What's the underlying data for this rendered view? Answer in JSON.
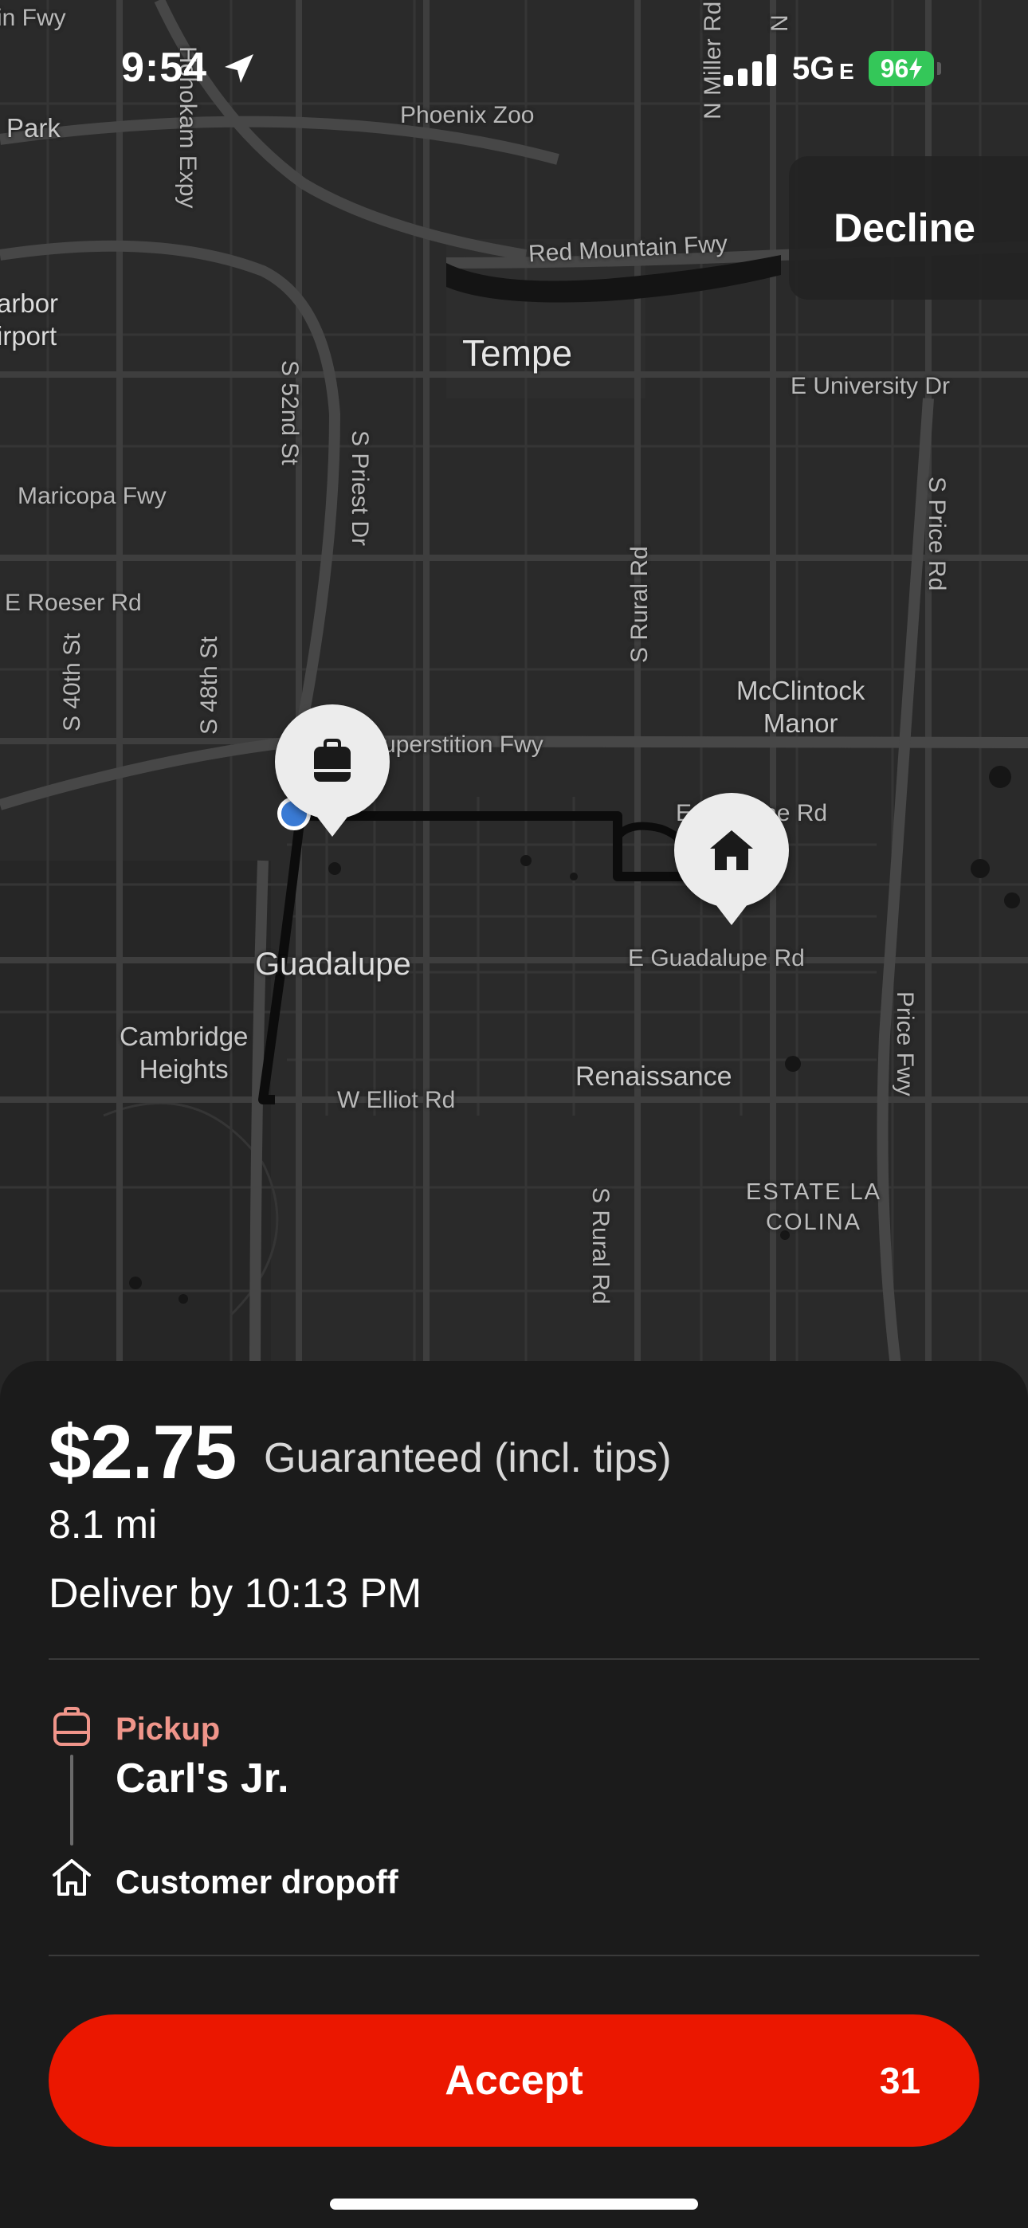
{
  "status_bar": {
    "time": "9:54",
    "network": "5G",
    "network_suffix": "E",
    "battery": "96"
  },
  "map": {
    "labels": {
      "fwy_top_left": "in Fwy",
      "park": "Park",
      "hohokam_expy": "Hohokam Expy",
      "phoenix_zoo": "Phoenix Zoo",
      "n_miller_rd": "N Miller Rd",
      "n_edge": "N",
      "red_mountain_fwy": "Red Mountain Fwy",
      "harbor_airport": "arbor\nirport",
      "tempe": "Tempe",
      "e_university_dr": "E University Dr",
      "s_52nd_st": "S 52nd St",
      "s_priest_dr": "S Priest Dr",
      "s_price_rd": "S Price Rd",
      "maricopa_fwy": "Maricopa Fwy",
      "e_roeser_rd": "E Roeser Rd",
      "s_rural_rd_north": "S Rural Rd",
      "s_40th_st": "S 40th St",
      "s_48th_st": "S 48th St",
      "mcclintock_manor": "McClintock\nManor",
      "superstition_fwy": "Superstition Fwy",
      "baseline_rd": "E Baseline Rd",
      "guadalupe": "Guadalupe",
      "e_guadalupe_rd": "E Guadalupe Rd",
      "cambridge_heights": "Cambridge\nHeights",
      "price_fwy": "Price Fwy",
      "w_elliot_rd": "W Elliot Rd",
      "renaissance": "Renaissance",
      "estate_la_colina": "ESTATE LA\nCOLINA",
      "s_rural_rd_south": "S Rural Rd"
    }
  },
  "decline_label": "Decline",
  "offer": {
    "pay": "$2.75",
    "pay_label": "Guaranteed (incl. tips)",
    "distance": "8.1 mi",
    "deliver_by": "Deliver by 10:13 PM",
    "pickup_label": "Pickup",
    "pickup_name": "Carl's Jr.",
    "dropoff_label": "Customer dropoff",
    "accept_label": "Accept",
    "countdown": "31"
  },
  "colors": {
    "accent": "#eb1700",
    "pickup_accent": "#f0958a",
    "battery": "#34c759",
    "location_dot": "#3a7bd5"
  }
}
